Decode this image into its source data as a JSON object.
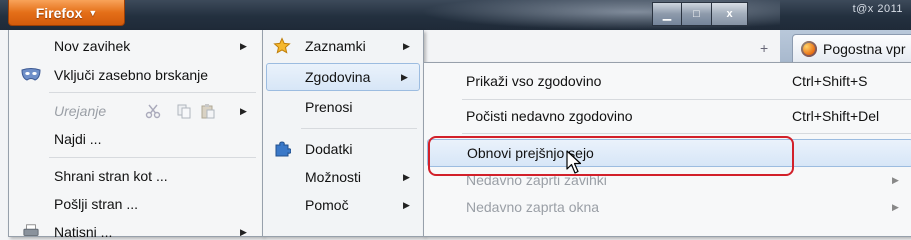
{
  "window": {
    "app_button": "Firefox",
    "edge_text": "t@x 2011",
    "new_tab_symbol": "+",
    "tab_title": "Pogostna vpr",
    "controls": {
      "minimize": "▁",
      "maximize": "□",
      "close": "x"
    }
  },
  "main_menu": {
    "items": [
      {
        "label": "Nov zavihek",
        "arrow": "▶"
      },
      {
        "label": "Vključi zasebno brskanje"
      },
      {
        "label": "Urejanje",
        "arrow": "▶"
      },
      {
        "label": "Najdi ..."
      },
      {
        "label": "Shrani stran kot ..."
      },
      {
        "label": "Pošlji stran ..."
      },
      {
        "label": "Natisni ...",
        "arrow": "▶"
      }
    ]
  },
  "side_menu": {
    "items": [
      {
        "label": "Zaznamki",
        "arrow": "▶"
      },
      {
        "label": "Zgodovina",
        "arrow": "▶"
      },
      {
        "label": "Prenosi"
      },
      {
        "label": "Dodatki"
      },
      {
        "label": "Možnosti",
        "arrow": "▶"
      },
      {
        "label": "Pomoč",
        "arrow": "▶"
      }
    ]
  },
  "history_menu": {
    "items": [
      {
        "label": "Prikaži vso zgodovino",
        "shortcut": "Ctrl+Shift+S"
      },
      {
        "label": "Počisti nedavno zgodovino",
        "shortcut": "Ctrl+Shift+Del"
      },
      {
        "label": "Obnovi prejšnjo sejo"
      },
      {
        "label": "Nedavno zaprti zavihki",
        "arrow": "▶"
      },
      {
        "label": "Nedavno zaprta okna",
        "arrow": "▶"
      }
    ]
  },
  "colors": {
    "firefox_orange": "#e46f18",
    "annotation_red": "#d2202a",
    "highlight_blue": "#d7e6f7"
  }
}
